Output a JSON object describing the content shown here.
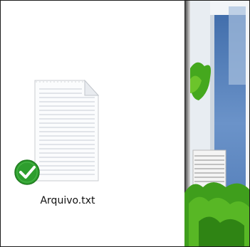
{
  "desktop": {
    "file": {
      "name": "Arquivo.txt",
      "icon": "text-file-icon",
      "status_icon": "check-icon",
      "status": "synced"
    }
  },
  "colors": {
    "status_green": "#2e9e2e",
    "wallpaper_sky": "#5f87bd",
    "wallpaper_foliage": "#43a61d"
  }
}
